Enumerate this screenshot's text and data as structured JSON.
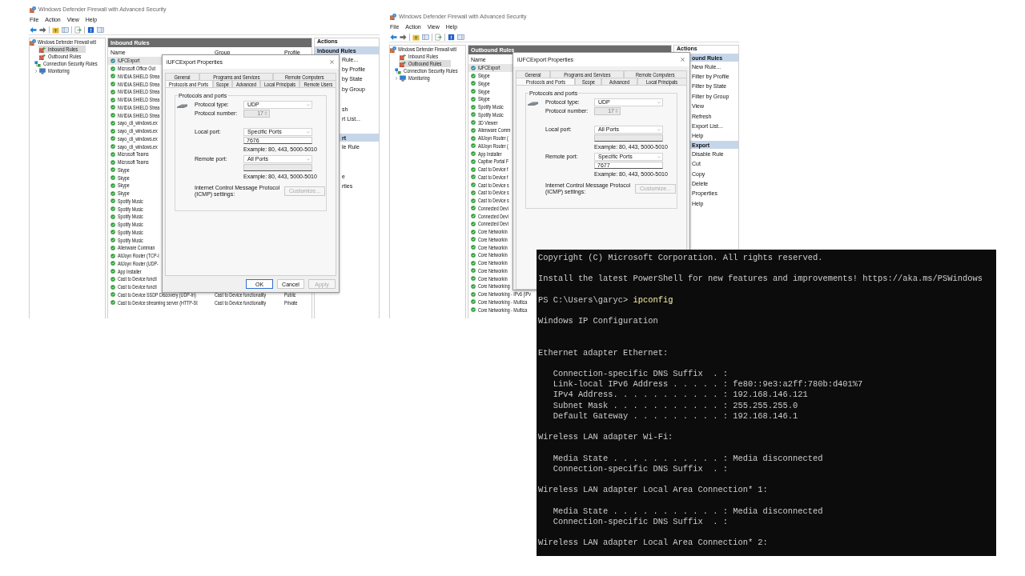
{
  "windows": [
    {
      "title": "Windows Defender Firewall with Advanced Security",
      "menu": [
        "File",
        "Action",
        "View",
        "Help"
      ],
      "tree": {
        "label": "Windows Defender Firewall witl",
        "kind": "firewall",
        "selected": false,
        "children": [
          {
            "label": "Inbound Rules",
            "kind": "inbound",
            "selected": true
          },
          {
            "label": "Outbound Rules",
            "kind": "outbound",
            "selected": false
          },
          {
            "label": "Connection Security Rules",
            "kind": "connection",
            "selected": false
          },
          {
            "label": "Monitoring",
            "kind": "monitoring",
            "selected": false,
            "expanded": false
          }
        ]
      },
      "pane_title": "Inbound Rules",
      "columns": [
        "Name",
        "Group",
        "Profile"
      ],
      "rows": [
        {
          "name": "iUFCExport",
          "selected": true
        },
        {
          "name": "Microsoft Office Out",
          "selected": false
        },
        {
          "name": "NVIDIA SHIELD Strea",
          "selected": false
        },
        {
          "name": "NVIDIA SHIELD Strea",
          "selected": false
        },
        {
          "name": "NVIDIA SHIELD Strea",
          "selected": false
        },
        {
          "name": "NVIDIA SHIELD Strea",
          "selected": false
        },
        {
          "name": "NVIDIA SHIELD Strea",
          "selected": false
        },
        {
          "name": "NVIDIA SHIELD Strea",
          "selected": false
        },
        {
          "name": "sayo_cli_windows.ex",
          "selected": false
        },
        {
          "name": "sayo_cli_windows.ex",
          "selected": false
        },
        {
          "name": "sayo_cli_windows.ex",
          "selected": false
        },
        {
          "name": "sayo_cli_windows.ex",
          "selected": false
        },
        {
          "name": "Microsoft Teams",
          "selected": false
        },
        {
          "name": "Microsoft Teams",
          "selected": false
        },
        {
          "name": "Skype",
          "selected": false
        },
        {
          "name": "Skype",
          "selected": false
        },
        {
          "name": "Skype",
          "selected": false
        },
        {
          "name": "Skype",
          "selected": false
        },
        {
          "name": "Spotify Music",
          "selected": false
        },
        {
          "name": "Spotify Music",
          "selected": false
        },
        {
          "name": "Spotify Music",
          "selected": false
        },
        {
          "name": "Spotify Music",
          "selected": false
        },
        {
          "name": "Spotify Music",
          "selected": false
        },
        {
          "name": "Spotify Music",
          "selected": false
        },
        {
          "name": "Alienware Comman",
          "selected": false
        },
        {
          "name": "AllJoyn Router (TCP-I",
          "selected": false
        },
        {
          "name": "AllJoyn Router (UDP-",
          "selected": false
        },
        {
          "name": "App Installer",
          "selected": false
        },
        {
          "name": "Cast to Device functi",
          "selected": false
        },
        {
          "name": "Cast to Device functi",
          "selected": false
        },
        {
          "name": "Cast to Device SSDP Discovery (UDP-In)",
          "group": "Cast to Device functionality",
          "profile": "Public",
          "selected": false
        },
        {
          "name": "Cast to Device streaming server (HTTP-St",
          "group": "Cast to Device functionality",
          "profile": "Private",
          "selected": false
        }
      ],
      "actions": [
        {
          "kind": "header",
          "label": "Actions"
        },
        {
          "kind": "section",
          "label": "Inbound Rules"
        },
        {
          "kind": "item",
          "label": "Rule..."
        },
        {
          "kind": "item",
          "label": "by Profile"
        },
        {
          "kind": "item",
          "label": "by State"
        },
        {
          "kind": "item",
          "label": "by Group"
        },
        {
          "kind": "covered"
        },
        {
          "kind": "item",
          "label": "sh"
        },
        {
          "kind": "item",
          "label": "rt List..."
        },
        {
          "kind": "covered"
        },
        {
          "kind": "section",
          "label": "rt"
        },
        {
          "kind": "item",
          "label": "le Rule"
        },
        {
          "kind": "covered"
        },
        {
          "kind": "covered"
        },
        {
          "kind": "item",
          "label": "e"
        },
        {
          "kind": "item",
          "label": "rties"
        }
      ],
      "dialog": {
        "title": "iUFCExport Properties",
        "tabs": [
          [
            {
              "label": "General",
              "selected": false
            },
            {
              "label": "Programs and Services",
              "selected": false
            },
            {
              "label": "Remote Computers",
              "selected": false
            }
          ],
          [
            {
              "label": "Protocols and Ports",
              "selected": true
            },
            {
              "label": "Scope",
              "selected": false
            },
            {
              "label": "Advanced",
              "selected": false
            },
            {
              "label": "Local Principals",
              "selected": false
            },
            {
              "label": "Remote Users",
              "selected": false
            }
          ]
        ],
        "group_title": "Protocols and ports",
        "protocol_type": {
          "label": "Protocol type:",
          "value": "UDP"
        },
        "protocol_number": {
          "label": "Protocol number:",
          "value": "17",
          "disabled": true
        },
        "ports": [
          {
            "label": "Local port:",
            "mode": "Specific Ports",
            "value": "7676",
            "disabled": false,
            "example": "Example: 80, 443, 5000-5010"
          },
          {
            "label": "Remote port:",
            "mode": "All Ports",
            "disabled": true,
            "example": "Example: 80, 443, 5000-5010"
          }
        ],
        "icmp": {
          "label": "Internet Control Message Protocol (ICMP) settings:",
          "button": "Customize...",
          "disabled": true
        },
        "buttons": [
          {
            "label": "OK",
            "default": true,
            "disabled": false
          },
          {
            "label": "Cancel",
            "default": false,
            "disabled": false
          },
          {
            "label": "Apply",
            "default": false,
            "disabled": true
          }
        ]
      }
    },
    {
      "title": "Windows Defender Firewall with Advanced Security",
      "menu": [
        "File",
        "Action",
        "View",
        "Help"
      ],
      "tree": {
        "label": "Windows Defender Firewall witl",
        "kind": "firewall",
        "selected": false,
        "children": [
          {
            "label": "Inbound Rules",
            "kind": "inbound",
            "selected": false
          },
          {
            "label": "Outbound Rules",
            "kind": "outbound",
            "selected": true
          },
          {
            "label": "Connection Security Rules",
            "kind": "connection",
            "selected": false
          },
          {
            "label": "Monitoring",
            "kind": "monitoring",
            "selected": false,
            "expanded": false
          }
        ]
      },
      "pane_title": "Outbound Rules",
      "columns": [
        "Name"
      ],
      "rows": [
        {
          "name": "iUFCExport",
          "selected": true
        },
        {
          "name": "Skype",
          "selected": false
        },
        {
          "name": "Skype",
          "selected": false
        },
        {
          "name": "Skype",
          "selected": false
        },
        {
          "name": "Skype",
          "selected": false
        },
        {
          "name": "Spotify Music",
          "selected": false
        },
        {
          "name": "Spotify Music",
          "selected": false
        },
        {
          "name": "3D Viewer",
          "selected": false
        },
        {
          "name": "Alienware Comm",
          "selected": false
        },
        {
          "name": "AllJoyn Router (",
          "selected": false
        },
        {
          "name": "AllJoyn Router (",
          "selected": false
        },
        {
          "name": "App Installer",
          "selected": false
        },
        {
          "name": "Captive Portal F",
          "selected": false
        },
        {
          "name": "Cast to Device f",
          "selected": false
        },
        {
          "name": "Cast to Device f",
          "selected": false
        },
        {
          "name": "Cast to Device s",
          "selected": false
        },
        {
          "name": "Cast to Device s",
          "selected": false
        },
        {
          "name": "Cast to Device s",
          "selected": false
        },
        {
          "name": "Connected Devi",
          "selected": false
        },
        {
          "name": "Connected Devi",
          "selected": false
        },
        {
          "name": "Connected Devi",
          "selected": false
        },
        {
          "name": "Core Networkin",
          "selected": false
        },
        {
          "name": "Core Networkin",
          "selected": false
        },
        {
          "name": "Core Networkin",
          "selected": false
        },
        {
          "name": "Core Networkin",
          "selected": false
        },
        {
          "name": "Core Networkin",
          "selected": false
        },
        {
          "name": "Core Networkin",
          "selected": false
        },
        {
          "name": "Core Networkin",
          "selected": false
        },
        {
          "name": "Core Networking",
          "selected": false
        },
        {
          "name": "Core Networking - IPv6 (IPv",
          "selected": false
        },
        {
          "name": "Core Networking - Multica",
          "selected": false
        },
        {
          "name": "Core Networking - Multica",
          "selected": false
        }
      ],
      "actions": [
        {
          "kind": "header",
          "label": "Actions"
        },
        {
          "kind": "section",
          "label": "ound Rules"
        },
        {
          "kind": "item",
          "label": "New Rule..."
        },
        {
          "kind": "item",
          "label": "Filter by Profile"
        },
        {
          "kind": "item",
          "label": "Filter by State"
        },
        {
          "kind": "item",
          "label": "Filter by Group"
        },
        {
          "kind": "item",
          "label": "View"
        },
        {
          "kind": "item",
          "label": "Refresh"
        },
        {
          "kind": "item",
          "label": "Export List..."
        },
        {
          "kind": "item",
          "label": "Help"
        },
        {
          "kind": "section",
          "label": "Export"
        },
        {
          "kind": "item",
          "label": "Disable Rule"
        },
        {
          "kind": "item",
          "label": "Cut"
        },
        {
          "kind": "item",
          "label": "Copy"
        },
        {
          "kind": "item",
          "label": "Delete"
        },
        {
          "kind": "item",
          "label": "Properties"
        },
        {
          "kind": "item",
          "label": "Help"
        }
      ],
      "dialog": {
        "title": "iUFCExport Properties",
        "tabs": [
          [
            {
              "label": "General",
              "selected": false
            },
            {
              "label": "Programs and Services",
              "selected": false
            },
            {
              "label": "Remote Computers",
              "selected": false
            }
          ],
          [
            {
              "label": "Protocols and Ports",
              "selected": true
            },
            {
              "label": "Scope",
              "selected": false
            },
            {
              "label": "Advanced",
              "selected": false
            },
            {
              "label": "Local Principals",
              "selected": false
            }
          ]
        ],
        "group_title": "Protocols and ports",
        "protocol_type": {
          "label": "Protocol type:",
          "value": "UDP"
        },
        "protocol_number": {
          "label": "Protocol number:",
          "value": "17",
          "disabled": true
        },
        "ports": [
          {
            "label": "Local port:",
            "mode": "All Ports",
            "disabled": true,
            "example": "Example: 80, 443, 5000-5010"
          },
          {
            "label": "Remote port:",
            "mode": "Specific Ports",
            "value": "7677",
            "disabled": false,
            "example": "Example: 80, 443, 5000-5010"
          }
        ],
        "icmp": {
          "label": "Internet Control Message Protocol (ICMP) settings:",
          "button": "Customize...",
          "disabled": true
        }
      }
    }
  ],
  "terminal": {
    "lines": [
      {
        "kind": "text",
        "text": "Copyright (C) Microsoft Corporation. All rights reserved."
      },
      {
        "kind": "blank"
      },
      {
        "kind": "text",
        "text": "Install the latest PowerShell for new features and improvements! https://aka.ms/PSWindows"
      },
      {
        "kind": "blank"
      },
      {
        "kind": "prompt",
        "prompt": "PS C:\\Users\\garyc>",
        "command": "ipconfig"
      },
      {
        "kind": "blank"
      },
      {
        "kind": "text",
        "text": "Windows IP Configuration"
      },
      {
        "kind": "blank"
      },
      {
        "kind": "blank"
      },
      {
        "kind": "text",
        "text": "Ethernet adapter Ethernet:"
      },
      {
        "kind": "blank"
      },
      {
        "kind": "text",
        "text": "   Connection-specific DNS Suffix  . :"
      },
      {
        "kind": "text",
        "text": "   Link-local IPv6 Address . . . . . : fe80::9e3:a2ff:780b:d401%7"
      },
      {
        "kind": "text",
        "text": "   IPv4 Address. . . . . . . . . . . : 192.168.146.121"
      },
      {
        "kind": "text",
        "text": "   Subnet Mask . . . . . . . . . . . : 255.255.255.0"
      },
      {
        "kind": "text",
        "text": "   Default Gateway . . . . . . . . . : 192.168.146.1"
      },
      {
        "kind": "blank"
      },
      {
        "kind": "text",
        "text": "Wireless LAN adapter Wi-Fi:"
      },
      {
        "kind": "blank"
      },
      {
        "kind": "text",
        "text": "   Media State . . . . . . . . . . . : Media disconnected"
      },
      {
        "kind": "text",
        "text": "   Connection-specific DNS Suffix  . :"
      },
      {
        "kind": "blank"
      },
      {
        "kind": "text",
        "text": "Wireless LAN adapter Local Area Connection* 1:"
      },
      {
        "kind": "blank"
      },
      {
        "kind": "text",
        "text": "   Media State . . . . . . . . . . . : Media disconnected"
      },
      {
        "kind": "text",
        "text": "   Connection-specific DNS Suffix  . :"
      },
      {
        "kind": "blank"
      },
      {
        "kind": "text",
        "text": "Wireless LAN adapter Local Area Connection* 2:"
      }
    ]
  }
}
